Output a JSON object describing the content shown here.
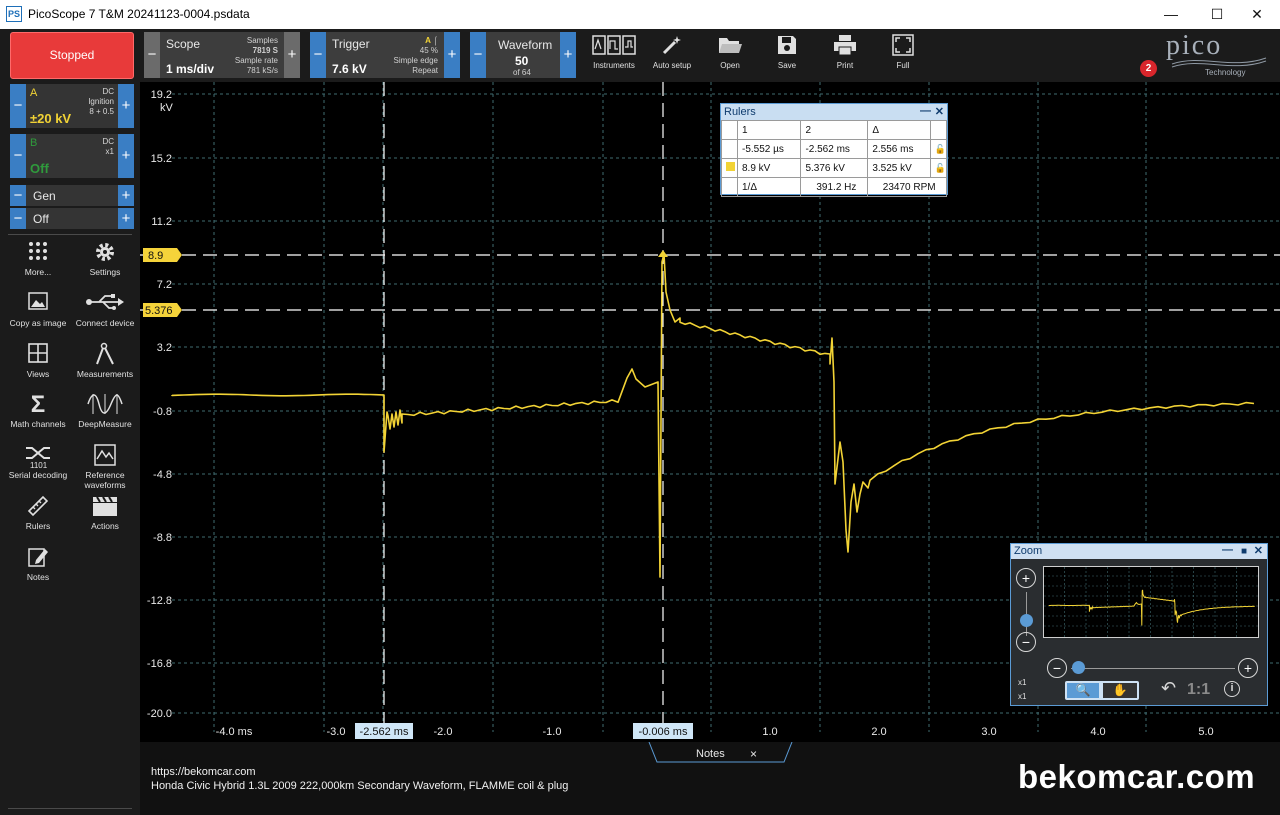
{
  "window": {
    "title": "PicoScope 7 T&M 20241123-0004.psdata",
    "icon": "picoscope-app-icon",
    "controls": [
      "—",
      "☐",
      "✕"
    ]
  },
  "toolbar": {
    "status": "Stopped",
    "scope": {
      "label": "Scope",
      "value": "1 ms/div",
      "samples_label": "Samples",
      "samples": "7819 S",
      "rate_label": "Sample rate",
      "rate": "781 kS/s"
    },
    "trigger": {
      "label": "Trigger",
      "value": "7.6 kV",
      "channel": "A",
      "percent": "45 %",
      "mode": "Simple edge",
      "type": "Repeat"
    },
    "waveform": {
      "label": "Waveform",
      "value": "50",
      "of": "of 64"
    },
    "tools": [
      {
        "label": "Instruments",
        "icon": "instruments-icon"
      },
      {
        "label": "Auto setup",
        "icon": "auto-setup-wand-icon"
      },
      {
        "label": "Open",
        "icon": "folder-open-icon"
      },
      {
        "label": "Save",
        "icon": "floppy-save-icon"
      },
      {
        "label": "Print",
        "icon": "printer-icon"
      },
      {
        "label": "Full",
        "icon": "fullscreen-icon"
      }
    ],
    "logo": {
      "word": "pico",
      "sub": "Technology"
    },
    "notification_count": "2"
  },
  "channels": [
    {
      "name": "A",
      "coupling": "DC",
      "probe": "Ignition",
      "probe2": "8 + 0.5",
      "range": "±20 kV",
      "color": "#f2d335"
    },
    {
      "name": "B",
      "coupling": "DC",
      "probe": "x1",
      "range": "Off",
      "color": "#2f9a3c"
    }
  ],
  "generator": {
    "label": "Gen",
    "value": "Off"
  },
  "side_tools": [
    {
      "label": "More...",
      "icon": "more-dots-icon"
    },
    {
      "label": "Settings",
      "icon": "gear-icon"
    },
    {
      "label": "Copy as image",
      "icon": "image-copy-icon"
    },
    {
      "label": "Connect device",
      "icon": "usb-icon"
    },
    {
      "label": "Views",
      "icon": "views-grid-icon"
    },
    {
      "label": "Measurements",
      "icon": "measurements-compass-icon"
    },
    {
      "label": "Math channels",
      "icon": "sigma-icon"
    },
    {
      "label": "DeepMeasure",
      "icon": "deepmeasure-wave-icon"
    },
    {
      "label": "Serial decoding",
      "icon": "serial-decoding-icon"
    },
    {
      "label": "Reference waveforms",
      "icon": "reference-waveforms-icon"
    },
    {
      "label": "Rulers",
      "icon": "ruler-icon"
    },
    {
      "label": "Actions",
      "icon": "clapperboard-icon"
    },
    {
      "label": "Notes",
      "icon": "notes-pencil-icon"
    }
  ],
  "plot": {
    "y_unit": "kV",
    "y_ticks": [
      "19.2",
      "15.2",
      "11.2",
      "7.2",
      "3.2",
      "-0.8",
      "-4.8",
      "-8.8",
      "-12.8",
      "-16.8",
      "-20.0"
    ],
    "x_ticks": [
      "-4.0 ms",
      "-3.0",
      "-2.0",
      "-1.0",
      "1.0",
      "2.0",
      "3.0",
      "4.0",
      "5.0"
    ],
    "ruler_labels": {
      "v1": "8.9",
      "v2": "5.376",
      "t1": "-2.562 ms",
      "t2": "-0.006 ms"
    },
    "trace_color": "#f2d335",
    "grid_color": "#3f6b70"
  },
  "rulers": {
    "title": "Rulers",
    "headers": [
      "1",
      "2",
      "Δ"
    ],
    "time_row": [
      "-5.552 µs",
      "-2.562 ms",
      "2.556 ms"
    ],
    "volt_row": [
      "8.9 kV",
      "5.376 kV",
      "3.525 kV"
    ],
    "inv_label": "1/Δ",
    "freq": "391.2 Hz",
    "rpm": "23470 RPM"
  },
  "zoom": {
    "title": "Zoom",
    "x_label": "x1",
    "y_label": "x1",
    "ratio": "1:1"
  },
  "notes": {
    "tab": "Notes",
    "close": "×",
    "lines": [
      "https://bekomcar.com",
      "Honda Civic Hybrid 1.3L 2009 222,000km Secondary Waveform, FLAMME coil & plug"
    ]
  },
  "watermark": "bekomcar.com"
}
